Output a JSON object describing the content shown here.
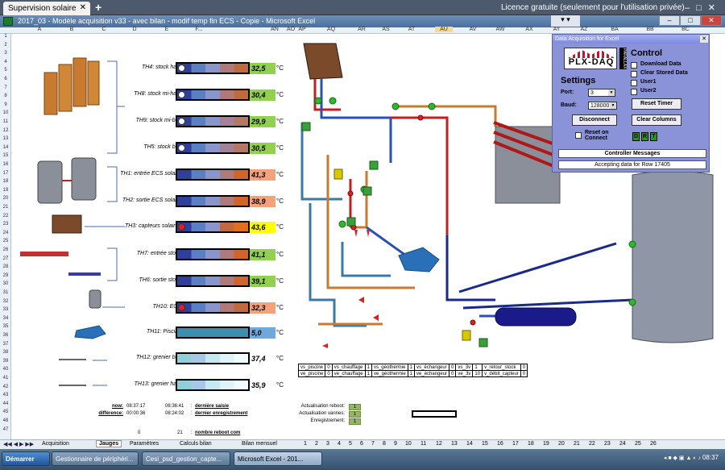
{
  "remote": {
    "tab_label": "Supervision solaire",
    "licence": "Licence gratuite (seulement pour l'utilisation privée)"
  },
  "excel": {
    "title": "2017_03 - Modèle acquisition v33 - avec bilan - modif temp fin ECS - Copie - Microsoft Excel"
  },
  "columns": [
    "A",
    "B",
    "C",
    "D",
    "E",
    "F...",
    "AN",
    "AO",
    "AP",
    "AQ",
    "AR",
    "AS",
    "AT",
    "AU",
    "AV",
    "AW",
    "AX",
    "AY",
    "AZ",
    "BA",
    "BB",
    "BC"
  ],
  "rows": [
    "1",
    "2",
    "3",
    "4",
    "5",
    "6",
    "7",
    "8",
    "9",
    "10",
    "11",
    "12",
    "13",
    "14",
    "15",
    "16",
    "17",
    "18",
    "19",
    "20",
    "21",
    "22",
    "23",
    "24",
    "25",
    "26",
    "27",
    "28",
    "29",
    "30",
    "31",
    "32",
    "33",
    "34",
    "35",
    "36",
    "37",
    "38",
    "39",
    "40",
    "41",
    "42",
    "43",
    "44",
    "45",
    "46",
    "47"
  ],
  "gauges": [
    {
      "label": "TH4: stock haut",
      "value": "32,5",
      "unit": "°C",
      "color": "#92d050",
      "dot": "#ffffff",
      "fill": [
        "#2f3f9a",
        "#5a7fc2",
        "#8a95cc",
        "#b07a7a",
        "#c06a40"
      ]
    },
    {
      "label": "TH8: stock mi-haut",
      "value": "30,4",
      "unit": "°C",
      "color": "#92d050",
      "dot": "#ffffff",
      "fill": [
        "#2f3f9a",
        "#5a7fc2",
        "#8a95cc",
        "#b07a7a",
        "#c06a40"
      ]
    },
    {
      "label": "TH9: stock mi-bas",
      "value": "29,9",
      "unit": "°C",
      "color": "#92d050",
      "dot": "#ffffff",
      "fill": [
        "#2f3f9a",
        "#5a7fc2",
        "#8a95cc",
        "#a58099",
        "#b57865"
      ]
    },
    {
      "label": "TH5: stock bas",
      "value": "30,5",
      "unit": "°C",
      "color": "#92d050",
      "dot": "#ffffff",
      "fill": [
        "#2f3f9a",
        "#5a7fc2",
        "#8a95cc",
        "#a58099",
        "#b57865"
      ]
    },
    {
      "label": "TH1: entrée ECS solaire",
      "value": "41,3",
      "unit": "°C",
      "color": "#f4a27a",
      "dot": "",
      "fill": [
        "#2f3f9a",
        "#5a7fc2",
        "#8a95cc",
        "#b07a7a",
        "#d0642a"
      ]
    },
    {
      "label": "TH2: sortie ECS solaire",
      "value": "38,9",
      "unit": "°C",
      "color": "#f4a27a",
      "dot": "",
      "fill": [
        "#2f3f9a",
        "#5a7fc2",
        "#8a95cc",
        "#b07a7a",
        "#d0642a"
      ]
    },
    {
      "label": "TH3: capteurs solaires",
      "value": "43,6",
      "unit": "°C",
      "color": "#ffff00",
      "dot": "#e02020",
      "fill": [
        "#2f3f9a",
        "#5a7fc2",
        "#8a95cc",
        "#c06a40",
        "#e07020"
      ]
    },
    {
      "label": "TH7: entrée stock",
      "value": "41,1",
      "unit": "°C",
      "color": "#92d050",
      "dot": "",
      "fill": [
        "#2f3f9a",
        "#5a7fc2",
        "#8a95cc",
        "#b07a7a",
        "#d0642a"
      ]
    },
    {
      "label": "TH6: sortie stock",
      "value": "39,1",
      "unit": "°C",
      "color": "#92d050",
      "dot": "",
      "fill": [
        "#2f3f9a",
        "#5a7fc2",
        "#8a95cc",
        "#b07a7a",
        "#d0642a"
      ]
    },
    {
      "label": "TH10: ECS",
      "value": "32,3",
      "unit": "°C",
      "color": "#f4a27a",
      "dot": "#e02020",
      "fill": [
        "#2f3f9a",
        "#5a7fc2",
        "#8a95cc",
        "#b07a7a",
        "#c06a40"
      ]
    },
    {
      "label": "TH11: Piscine",
      "value": "5,0",
      "unit": "°C",
      "color": "#6fa8dc",
      "dot": "",
      "fill": [
        "#3d8fb0",
        "#3d8fb0",
        "#3d8fb0",
        "#3d8fb0",
        "#3d8fb0"
      ]
    },
    {
      "label": "TH12: grenier bas",
      "value": "37,4",
      "unit": "°C",
      "color": "#ffffff",
      "dot": "",
      "fill": [
        "#8fd0d8",
        "#a8c7e6",
        "#c6e8f0",
        "#dff4f8",
        "#f0fbfd"
      ]
    },
    {
      "label": "TH13: grenier haut",
      "value": "35,9",
      "unit": "°C",
      "color": "#ffffff",
      "dot": "",
      "fill": [
        "#8fd0d8",
        "#a8c7e6",
        "#c6e8f0",
        "#dff4f8",
        "#f0fbfd"
      ]
    }
  ],
  "valve_table": [
    [
      "vs_piscine",
      "0",
      "vs_chauffage",
      "1",
      "vs_géothermie",
      "1",
      "vs_échangeur",
      "0",
      "vs_3v",
      "1",
      "v_retour_stock",
      "0"
    ],
    [
      "ve_piscine",
      "0",
      "ve_chauffage",
      "1",
      "ve_géothermie",
      "1",
      "ve_échangeur",
      "0",
      "ve_3v",
      "10",
      "v_débit_capteur",
      "0"
    ]
  ],
  "timing": {
    "now_label": "now:",
    "now_value": "08:37:17",
    "diff_label": "différence:",
    "diff_value": "00:00:36",
    "last_save_time": "08:36:41",
    "last_save_label": "dernière saisie",
    "last_record_time": "08:24:02",
    "last_record_label": "dernier enregistrement",
    "reboot_a": "0",
    "reboot_b": "21",
    "reboot_label": "nombre reboot com"
  },
  "status": [
    {
      "label": "Actualisation reboot:",
      "value": "1"
    },
    {
      "label": "Actualisation vannes:",
      "value": "1"
    },
    {
      "label": "Enregistrement:",
      "value": "1"
    }
  ],
  "daq": {
    "title": "Data Acquisition for Excel",
    "logo": "PLX-DAQ",
    "side_text": "PARALLAX",
    "control_heading": "Control",
    "settings_heading": "Settings",
    "checks": [
      "Download Data",
      "Clear Stored Data",
      "User1",
      "User2"
    ],
    "port_label": "Port:",
    "port_value": "3",
    "baud_label": "Baud:",
    "baud_value": "128000",
    "reset_timer": "Reset Timer",
    "disconnect": "Disconnect",
    "clear_columns": "Clear Columns",
    "reset_on_connect": "Reset on Connect",
    "leds": [
      "D",
      "R",
      "T"
    ],
    "controller_messages": "Controller Messages",
    "status_msg": "Accepting data for Row 17405"
  },
  "sheet_tabs": [
    "Acquisition",
    "Jauges",
    "Paramètres",
    "Calculs bilan",
    "Bilan mensuel",
    "1",
    "2",
    "3",
    "4",
    "5",
    "6",
    "7",
    "8",
    "9",
    "10",
    "11",
    "12",
    "13",
    "14",
    "15",
    "16",
    "17",
    "18",
    "19",
    "20",
    "21",
    "22",
    "23",
    "24",
    "25",
    "26"
  ],
  "taskbar": {
    "start": "Démarrer",
    "items": [
      "Gestionnaire de périphéri...",
      "Cesi_psd_gestion_capte...",
      "Microsoft Excel - 201..."
    ],
    "clock": "08:37"
  }
}
